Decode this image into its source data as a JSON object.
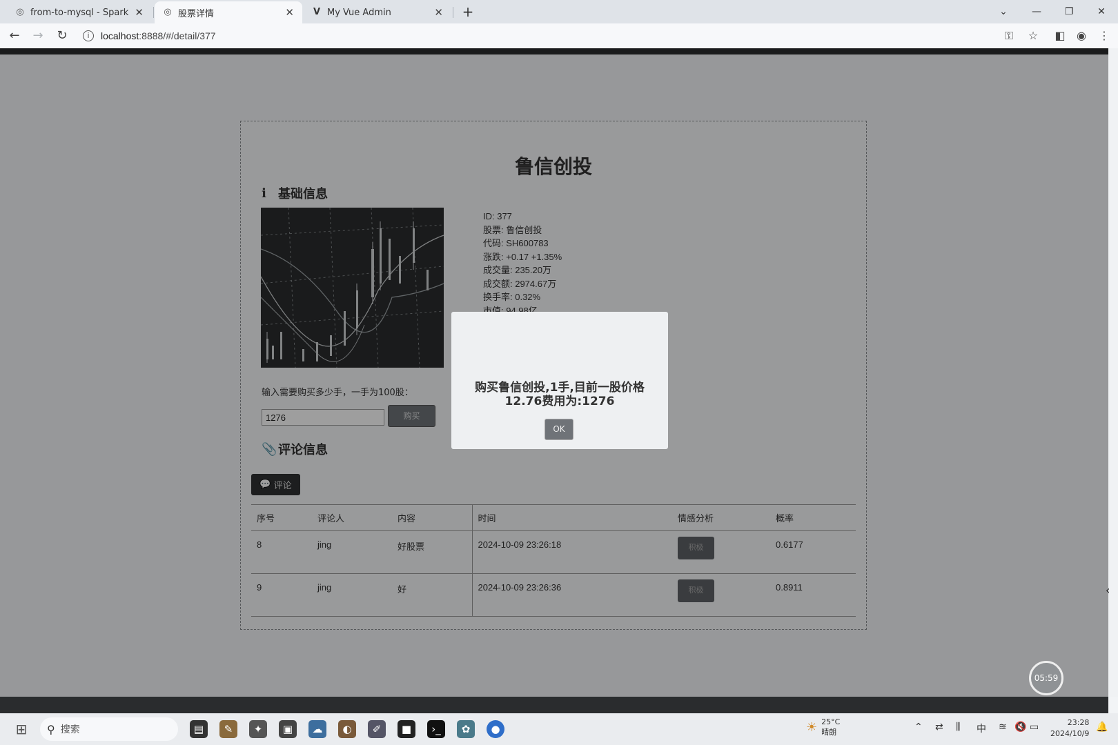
{
  "browser": {
    "tabs": [
      {
        "title": "from-to-mysql - Spark Jobs",
        "icon": "globe-icon"
      },
      {
        "title": "股票详情",
        "icon": "globe-icon"
      },
      {
        "title": "My Vue Admin",
        "icon": "vue-icon"
      }
    ],
    "url_host": "localhost",
    "url_port_path": ":8888/#/detail/377"
  },
  "page": {
    "stock_title": "鲁信创投",
    "basic_section": "基础信息",
    "info": {
      "id": "ID: 377",
      "name": "股票: 鲁信创投",
      "code": "代码: SH600783",
      "change": "涨跌: +0.17 +1.35%",
      "volume": "成交量: 235.20万",
      "turnover": "成交额: 2974.67万",
      "turnover_rate": "换手率: 0.32%",
      "market_cap": "市值: 94.98亿"
    },
    "buy_label": "输入需要购买多少手，一手为100股：",
    "buy_input_value": "1276",
    "buy_button": "购买",
    "comment_section": "评论信息",
    "comment_button": "评论",
    "table": {
      "headers": [
        "序号",
        "评论人",
        "内容",
        "时间",
        "情感分析",
        "概率"
      ],
      "rows": [
        {
          "no": "8",
          "user": "jing",
          "content": "好股票",
          "time": "2024-10-09 23:26:18",
          "sentiment": "积极",
          "prob": "0.6177"
        },
        {
          "no": "9",
          "user": "jing",
          "content": "好",
          "time": "2024-10-09 23:26:36",
          "sentiment": "积极",
          "prob": "0.8911"
        }
      ]
    }
  },
  "modal": {
    "line1": "购买鲁信创投,1手,目前一股价格",
    "line2": "12.76费用为:1276",
    "ok": "OK"
  },
  "timer": "05:59",
  "taskbar": {
    "search_placeholder": "搜索",
    "weather_temp": "25°C",
    "weather_desc": "晴朗",
    "ime": "中",
    "time": "23:28",
    "date": "2024/10/9"
  }
}
